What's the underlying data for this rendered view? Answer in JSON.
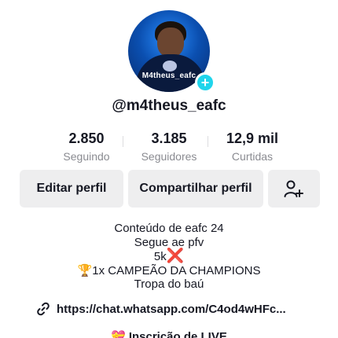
{
  "profile": {
    "avatar_text": "M4theus_eafc",
    "username": "@m4theus_eafc"
  },
  "stats": [
    {
      "value": "2.850",
      "label": "Seguindo"
    },
    {
      "value": "3.185",
      "label": "Seguidores"
    },
    {
      "value": "12,9 mil",
      "label": "Curtidas"
    }
  ],
  "actions": {
    "edit_label": "Editar perfil",
    "share_label": "Compartilhar perfil",
    "add_friend_icon": "add-friend-icon"
  },
  "bio": {
    "line1": "Conteúdo de eafc 24",
    "line2": "Segue ae pfv",
    "line3_text": "5k",
    "line3_emoji": "❌",
    "line4_emoji": "🏆",
    "line4_text": "1x CAMPEÃO DA CHAMPIONS",
    "line5": "Tropa do baú"
  },
  "link": {
    "icon": "link-icon",
    "text": "https://chat.whatsapp.com/C4od4wHFc..."
  },
  "partial": {
    "emoji": "💝",
    "text": "Inscrição de LIVE"
  },
  "colors": {
    "accent": "#20d5ec",
    "button_bg": "#eeeeef",
    "secondary_text": "#8a8b91"
  }
}
